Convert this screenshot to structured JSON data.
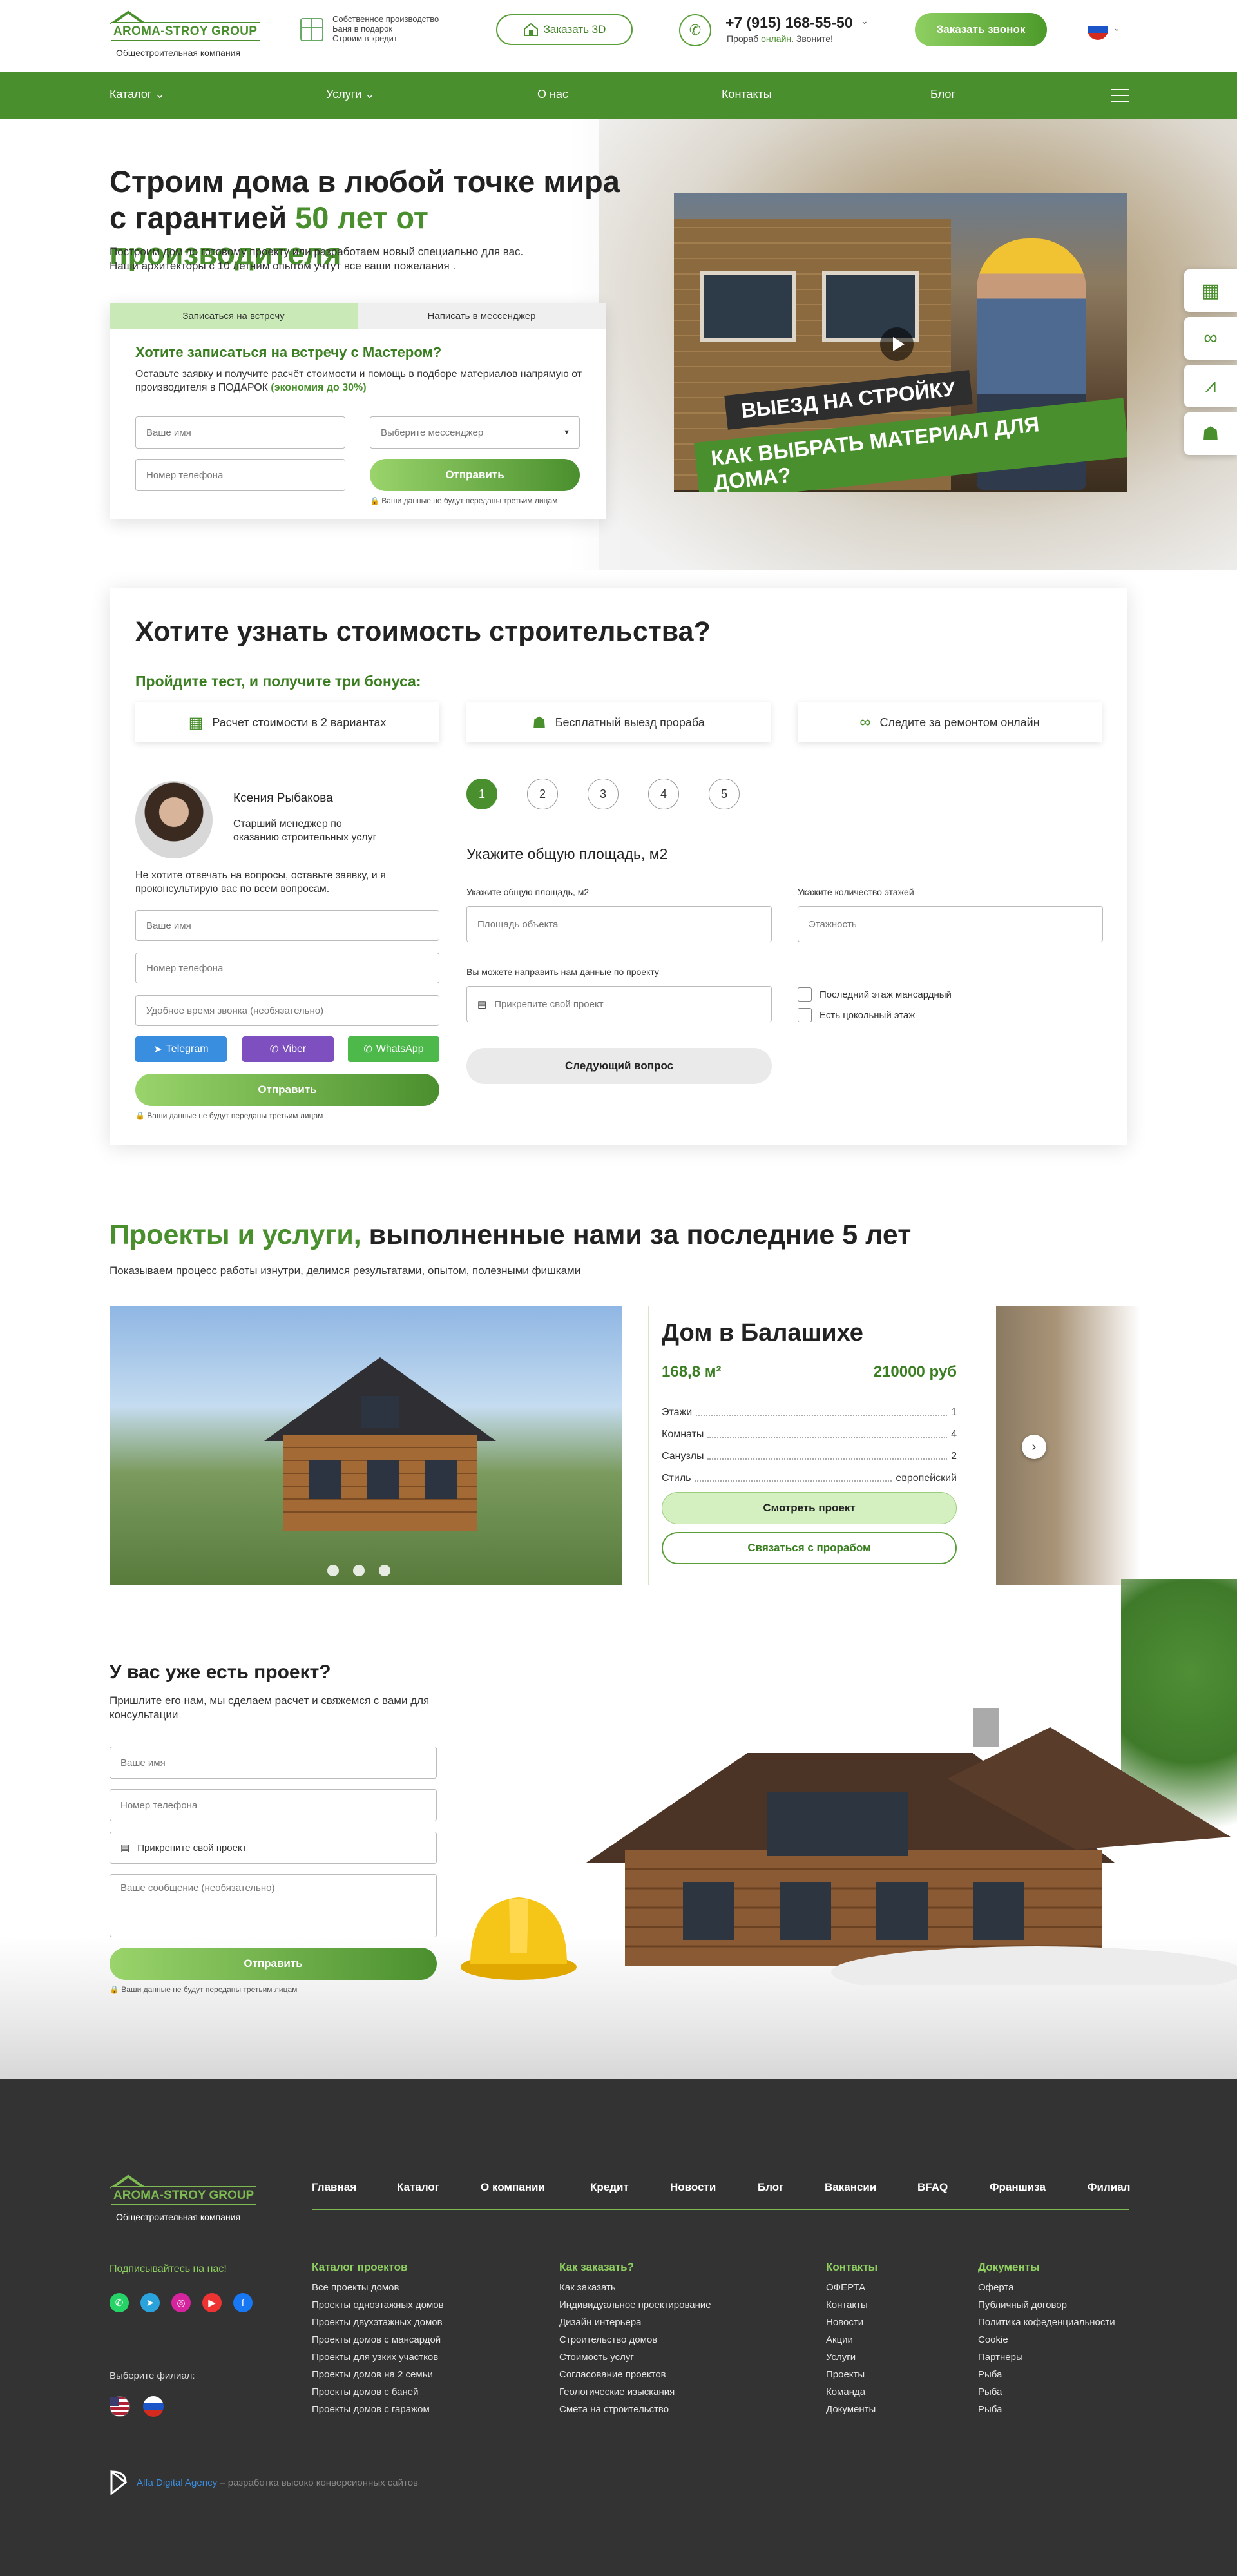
{
  "header": {
    "logo_name": "AROMA-STROY GROUP",
    "logo_sub": "Общестроительная компания",
    "features": [
      "Собственное производство",
      "Баня в подарок",
      "Строим в кредит"
    ],
    "order3d": "Заказать 3D",
    "phone": "+7 (915) 168-55-50",
    "phone_sub_prefix": "Прораб",
    "phone_online": "онлайн",
    "phone_sub_suffix": ". Звоните!",
    "call_button": "Заказать звонок"
  },
  "nav": [
    {
      "label": "Каталог",
      "dropdown": true
    },
    {
      "label": "Услуги",
      "dropdown": true
    },
    {
      "label": "О нас",
      "dropdown": false
    },
    {
      "label": "Контакты",
      "dropdown": false
    },
    {
      "label": "Блог",
      "dropdown": false
    }
  ],
  "hero": {
    "title_line1": "Строим дома в любой точке мира",
    "title_line2_a": "с гарантией ",
    "title_line2_b": "50 лет от производителя",
    "subtitle_1": "Построим дом по готовому проекту или разработаем новый специально для вас.",
    "subtitle_2": "Наши архитекторы с 10 летним опытом учтут все ваши пожелания .",
    "tab_1": "Записаться на встречу",
    "tab_2": "Написать в мессенджер",
    "form_title": "Хотите записаться на встречу с Мастером?",
    "form_desc_a": "Оставьте заявку и получите расчёт стоимости и помощь в подборе материалов напрямую от производителя в ПОДАРОК ",
    "form_desc_b": "(экономия до 30%)",
    "name_placeholder": "Ваше имя",
    "messenger_placeholder": "Выберите мессенджер",
    "phone_placeholder": "Номер телефона",
    "submit": "Отправить",
    "privacy": "Ваши данные не будут переданы третьим лицам",
    "video_banner_1": "ВЫЕЗД НА СТРОЙКУ",
    "video_banner_2": "КАК ВЫБРАТЬ МАТЕРИАЛ ДЛЯ ДОМА?"
  },
  "side_icons": [
    "calculator-icon",
    "binoculars-icon",
    "compass-icon",
    "worker-icon"
  ],
  "calc": {
    "title": "Хотите узнать стоимость строительства?",
    "subtitle": "Пройдите тест, и получите три бонуса:",
    "bonuses": [
      {
        "icon": "calculator-icon",
        "label": "Расчет стоимости в 2 вариантах"
      },
      {
        "icon": "worker-icon",
        "label": "Бесплатный выезд прораба"
      },
      {
        "icon": "binoculars-icon",
        "label": "Следите за ремонтом онлайн"
      }
    ],
    "manager_name": "Ксения Рыбакова",
    "manager_role": "Старший менеджер по оказанию строительных услуг",
    "manager_note": "Не хотите отвечать на вопросы, оставьте заявку, и я проконсультирую вас по всем вопросам.",
    "name_placeholder": "Ваше имя",
    "phone_placeholder": "Номер телефона",
    "time_placeholder": "Удобное время звонка (необязательно)",
    "telegram": "Telegram",
    "viber": "Viber",
    "whatsapp": "WhatsApp",
    "submit": "Отправить",
    "privacy": "Ваши данные не будут переданы третьим лицам",
    "steps": [
      "1",
      "2",
      "3",
      "4",
      "5"
    ],
    "question": "Укажите общую площадь, м2",
    "area_label": "Укажите общую площадь, м2",
    "area_placeholder": "Площадь объекта",
    "floors_label": "Укажите количество этажей",
    "floors_placeholder": "Этажность",
    "attach_label": "Вы можете направить нам данные по проекту",
    "attach_placeholder": "Прикрепите свой проект",
    "check_1": "Последний этаж мансардный",
    "check_2": "Есть цокольный этаж",
    "next": "Следующий вопрос"
  },
  "projects": {
    "title_a": "Проекты и услуги,",
    "title_b": " выполненные нами за последние 5 лет",
    "subtitle": "Показываем процесс работы изнутри, делимся результатами, опытом, полезными фишками",
    "card_title": "Дом в Балашихе",
    "area": "168,8 м²",
    "price": "210000 руб",
    "specs": [
      {
        "label": "Этажи",
        "value": "1"
      },
      {
        "label": "Комнаты",
        "value": "4"
      },
      {
        "label": "Санузлы",
        "value": "2"
      },
      {
        "label": "Стиль",
        "value": "европейский"
      }
    ],
    "view_button": "Смотреть проект",
    "contact_button": "Связаться с прорабом"
  },
  "have_project": {
    "title": "У вас уже есть проект?",
    "subtitle": "Пришлите его нам, мы сделаем расчет и свяжемся с вами для консультации",
    "name_placeholder": "Ваше имя",
    "phone_placeholder": "Номер телефона",
    "attach_placeholder": "Прикрепите свой проект",
    "message_placeholder": "Ваше сообщение (необязательно)",
    "submit": "Отправить",
    "privacy": "Ваши данные не будут переданы третьим лицам"
  },
  "footer": {
    "logo_name": "AROMA-STROY GROUP",
    "logo_sub": "Общестроительная компания",
    "nav": [
      "Главная",
      "Каталог",
      "О компании",
      "Кредит",
      "Новости",
      "Блог",
      "Вакансии",
      "BFAQ",
      "Франшиза",
      "Филиал"
    ],
    "subscribe": "Подписывайтесь на нас!",
    "branch": "Выберите филиал:",
    "col1_title": "Каталог проектов",
    "col1": [
      "Все проекты домов",
      "Проекты одноэтажных домов",
      "Проекты двухэтажных домов",
      "Проекты домов с мансардой",
      "Проекты для узких участков",
      "Проекты домов на 2 семьи",
      "Проекты домов с баней",
      "Проекты домов с гаражом"
    ],
    "col2_title": "Как заказать?",
    "col2": [
      "Как заказать",
      "Индивидуальное проектирование",
      "Дизайн интерьера",
      "Строительство домов",
      "Стоимость услуг",
      "Согласование проектов",
      "Геологические изыскания",
      "Смета на строительство"
    ],
    "col3_title": "Контакты",
    "col3": [
      "ОФЕРТА",
      "Контакты",
      "Новости",
      "Акции",
      "Услуги",
      "Проекты",
      "Команда",
      "Документы"
    ],
    "col4_title": "Документы",
    "col4": [
      "Оферта",
      "Публичный договор",
      "Политика кофеденциальности",
      "Cookie",
      "Партнеры",
      "Рыба",
      "Рыба",
      "Рыба"
    ],
    "agency_name": "Alfa Digital Agency",
    "agency_text": " – разработка высоко конверсионных сайтов"
  }
}
